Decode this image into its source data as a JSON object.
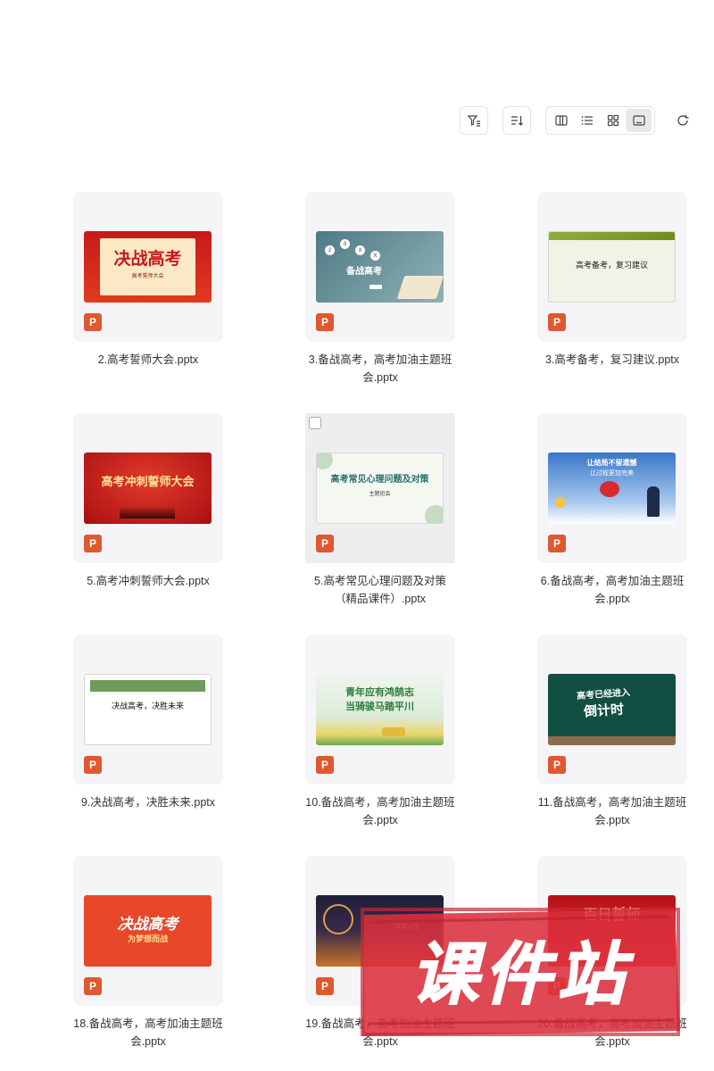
{
  "toolbar": {
    "filter": "filter-icon",
    "sort": "sort-icon",
    "views": [
      "columns-view-icon",
      "list-view-icon",
      "grid-view-icon",
      "preview-view-icon"
    ],
    "active_view": "preview-view-icon",
    "refresh": "refresh-icon"
  },
  "files": [
    {
      "name": "2.高考誓师大会.pptx",
      "thumb": {
        "title": "决战高考",
        "sub": "高考誓师大会"
      }
    },
    {
      "name": "3.备战高考，高考加油主题班会.pptx",
      "thumb": {
        "title": "备战高考",
        "bubbles": [
          "2",
          "0",
          "X",
          "X"
        ]
      }
    },
    {
      "name": "3.高考备考，复习建议.pptx",
      "thumb": {
        "title": "高考备考，复习建议"
      }
    },
    {
      "name": "5.高考冲刺誓师大会.pptx",
      "thumb": {
        "title": "高考冲刺誓师大会"
      }
    },
    {
      "name": "5.高考常见心理问题及对策（精品课件）.pptx",
      "thumb": {
        "title": "高考常见心理问题及对策",
        "sub": "主题班会"
      }
    },
    {
      "name": "6.备战高考，高考加油主题班会.pptx",
      "thumb": {
        "title": "让结局不留遗憾",
        "sub": "让过程更加完美"
      }
    },
    {
      "name": "9.决战高考，决胜未来.pptx",
      "thumb": {
        "title": "决战高考，决胜未来"
      }
    },
    {
      "name": "10.备战高考，高考加油主题班会.pptx",
      "thumb": {
        "title": "青年应有鸿鹄志",
        "sub": "当骑骏马踏平川"
      }
    },
    {
      "name": "11.备战高考，高考加油主题班会.pptx",
      "thumb": {
        "title": "高考已经进入",
        "sub": "倒计时"
      }
    },
    {
      "name": "18.备战高考，高考加油主题班会.pptx",
      "thumb": {
        "title": "决战高考",
        "sub": "为梦想而战"
      }
    },
    {
      "name": "19.备战高考，高考加油主题班会.pptx",
      "thumb": {
        "title": "",
        "sub": "改写人生"
      }
    },
    {
      "name": "20.备战高考，高考加油主题班会.pptx",
      "thumb": {
        "title": "百日誓师",
        "sub": ""
      }
    }
  ],
  "badge_label": "P",
  "watermark": {
    "text": "课件站"
  },
  "colors": {
    "accent_orange": "#e0582f",
    "tile_bg": "#f5f5f7",
    "watermark_red": "#d9303e"
  }
}
